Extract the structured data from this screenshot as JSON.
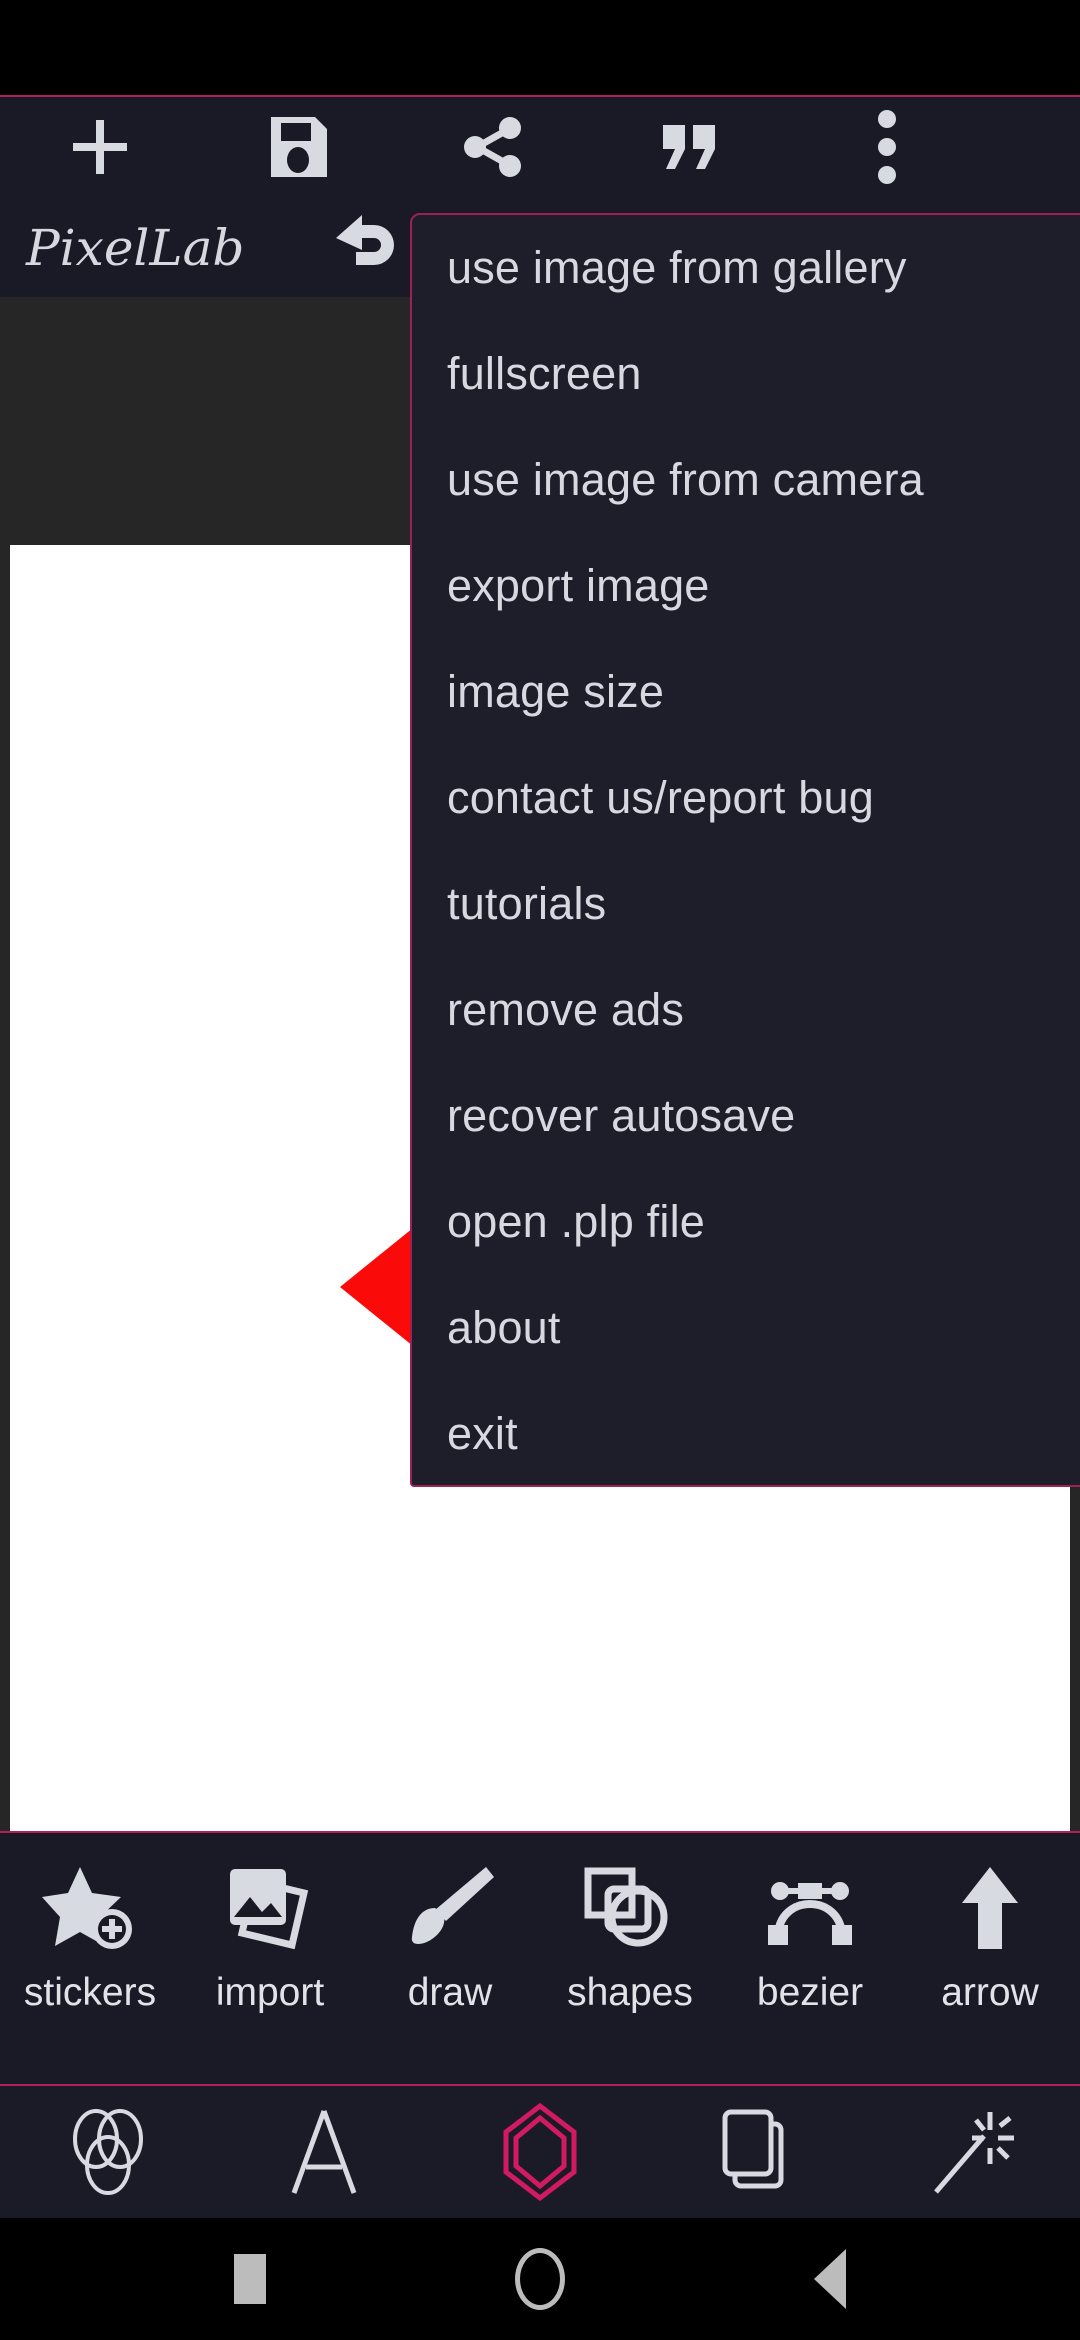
{
  "app": {
    "name": "PixelLab"
  },
  "colors": {
    "accent_pink": "#b0215c",
    "menu_border": "#9e2156",
    "toolbar_bg": "#1a1a27",
    "workspace_bg": "#262626",
    "canvas_bg": "#ffffff",
    "shape_red": "#fb0a0a",
    "icon_light": "#d8dae2",
    "active_nav": "#d21a63"
  },
  "topbar": {
    "buttons": [
      {
        "name": "add",
        "icon": "plus-icon"
      },
      {
        "name": "save",
        "icon": "save-icon"
      },
      {
        "name": "share",
        "icon": "share-icon"
      },
      {
        "name": "quote",
        "icon": "quote-icon"
      },
      {
        "name": "overflow",
        "icon": "more-vertical-icon"
      }
    ],
    "logo_text": "PixelLab",
    "undo": {
      "name": "undo",
      "icon": "undo-icon"
    }
  },
  "menu": {
    "items": [
      {
        "label": "use image from gallery"
      },
      {
        "label": "fullscreen"
      },
      {
        "label": "use image from camera"
      },
      {
        "label": "export image"
      },
      {
        "label": "image size"
      },
      {
        "label": "contact us/report bug"
      },
      {
        "label": "tutorials"
      },
      {
        "label": "remove ads"
      },
      {
        "label": "recover autosave"
      },
      {
        "label": "open .plp file"
      },
      {
        "label": "about"
      },
      {
        "label": "exit"
      }
    ]
  },
  "canvas": {
    "shape": "red-triangle-arrowhead"
  },
  "tools": [
    {
      "label": "stickers",
      "icon": "star-plus-icon"
    },
    {
      "label": "import",
      "icon": "photo-stack-icon"
    },
    {
      "label": "draw",
      "icon": "paintbrush-icon"
    },
    {
      "label": "shapes",
      "icon": "shapes-icon"
    },
    {
      "label": "bezier",
      "icon": "bezier-curve-icon"
    },
    {
      "label": "arrow",
      "icon": "arrow-up-icon"
    }
  ],
  "bottom_nav": [
    {
      "name": "blend",
      "icon": "venn-circles-icon",
      "active": false
    },
    {
      "name": "text",
      "icon": "letter-a-icon",
      "active": false
    },
    {
      "name": "shape",
      "icon": "hexagon-icon",
      "active": true
    },
    {
      "name": "layers",
      "icon": "layers-icon",
      "active": false
    },
    {
      "name": "effects",
      "icon": "magic-wand-icon",
      "active": false
    }
  ],
  "system_nav": [
    {
      "name": "recents",
      "icon": "square-icon"
    },
    {
      "name": "home",
      "icon": "circle-icon"
    },
    {
      "name": "back",
      "icon": "triangle-back-icon"
    }
  ]
}
